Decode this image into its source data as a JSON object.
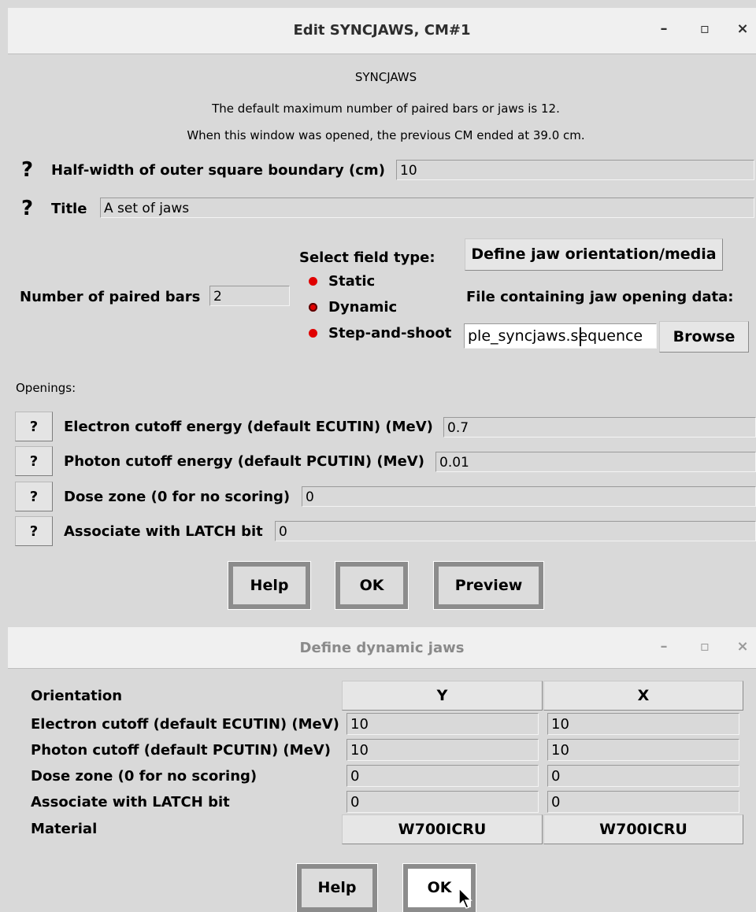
{
  "main_window": {
    "title": "Edit SYNCJAWS, CM#1",
    "controls": {
      "minimize": "–",
      "maximize": "▫",
      "close": "×"
    },
    "heading": "SYNCJAWS",
    "info1": "The default maximum number of paired bars or jaws is 12.",
    "info2": "When this window was opened, the previous CM ended at 39.0 cm.",
    "help_glyph": "?",
    "halfwidth": {
      "label": "Half-width of outer square boundary (cm)",
      "value": "10"
    },
    "title_field": {
      "label": "Title",
      "value": "A set of jaws"
    },
    "num_bars": {
      "label": "Number of paired bars",
      "value": "2"
    },
    "field_type": {
      "label": "Select field type:",
      "options": [
        "Static",
        "Dynamic",
        "Step-and-shoot"
      ],
      "selected": "Dynamic"
    },
    "define_button": "Define jaw orientation/media",
    "file_label": "File containing jaw opening data:",
    "file_value": "ple_syncjaws.sequence",
    "browse_button": "Browse",
    "openings_label": "Openings:",
    "params": [
      {
        "label": "Electron cutoff energy (default ECUTIN) (MeV)",
        "value": "0.7"
      },
      {
        "label": "Photon cutoff energy (default PCUTIN) (MeV)",
        "value": "0.01"
      },
      {
        "label": "Dose zone (0 for no scoring)",
        "value": "0"
      },
      {
        "label": "Associate with LATCH bit",
        "value": "0"
      }
    ],
    "buttons": {
      "help": "Help",
      "ok": "OK",
      "preview": "Preview"
    }
  },
  "dialog": {
    "title": "Define dynamic jaws",
    "controls": {
      "minimize": "–",
      "maximize": "▫",
      "close": "×"
    },
    "rows": {
      "orientation": "Orientation",
      "electron": "Electron cutoff (default ECUTIN) (MeV)",
      "photon": "Photon cutoff (default PCUTIN) (MeV)",
      "dose": "Dose zone (0 for no scoring)",
      "latch": "Associate with LATCH bit",
      "material": "Material"
    },
    "columns": [
      {
        "orientation": "Y",
        "electron": "10",
        "photon": "10",
        "dose": "0",
        "latch": "0",
        "material": "W700ICRU"
      },
      {
        "orientation": "X",
        "electron": "10",
        "photon": "10",
        "dose": "0",
        "latch": "0",
        "material": "W700ICRU"
      }
    ],
    "buttons": {
      "help": "Help",
      "ok": "OK"
    }
  }
}
